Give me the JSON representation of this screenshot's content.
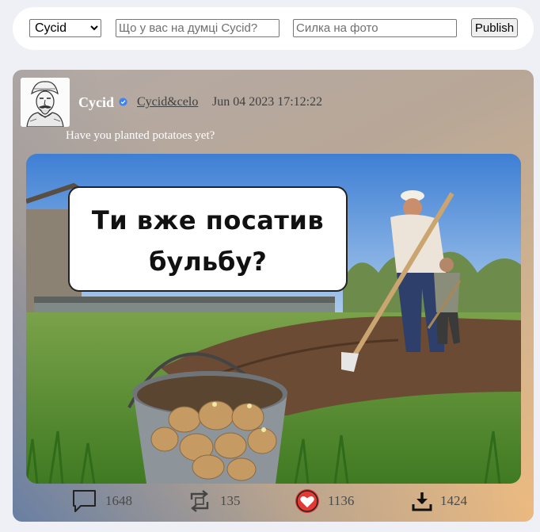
{
  "compose": {
    "user_options": [
      "Cycid"
    ],
    "selected_user": "Cycid",
    "status_placeholder": "Що у вас на думці Cycid?",
    "photo_placeholder": "Силка на фото",
    "publish_label": "Publish"
  },
  "post": {
    "author_name": "Cycid",
    "author_handle": "Cycid&celo",
    "date": "Jun 04 2023 17:12:22",
    "text": "Have you planted potatoes yet?",
    "image": {
      "caption_line1": "Ти вже посатив",
      "caption_line2": "бульбу?"
    },
    "actions": {
      "comments": "1648",
      "reposts": "135",
      "likes": "1136",
      "downloads": "1424"
    }
  },
  "colors": {
    "page_bg": "#eef0f5",
    "like_red": "#e53935",
    "icon_dark": "#222222",
    "verified_blue": "#3b82f6"
  },
  "icons": [
    "chevron-down-icon",
    "verified-icon",
    "comment-icon",
    "repost-icon",
    "heart-icon",
    "download-icon"
  ]
}
